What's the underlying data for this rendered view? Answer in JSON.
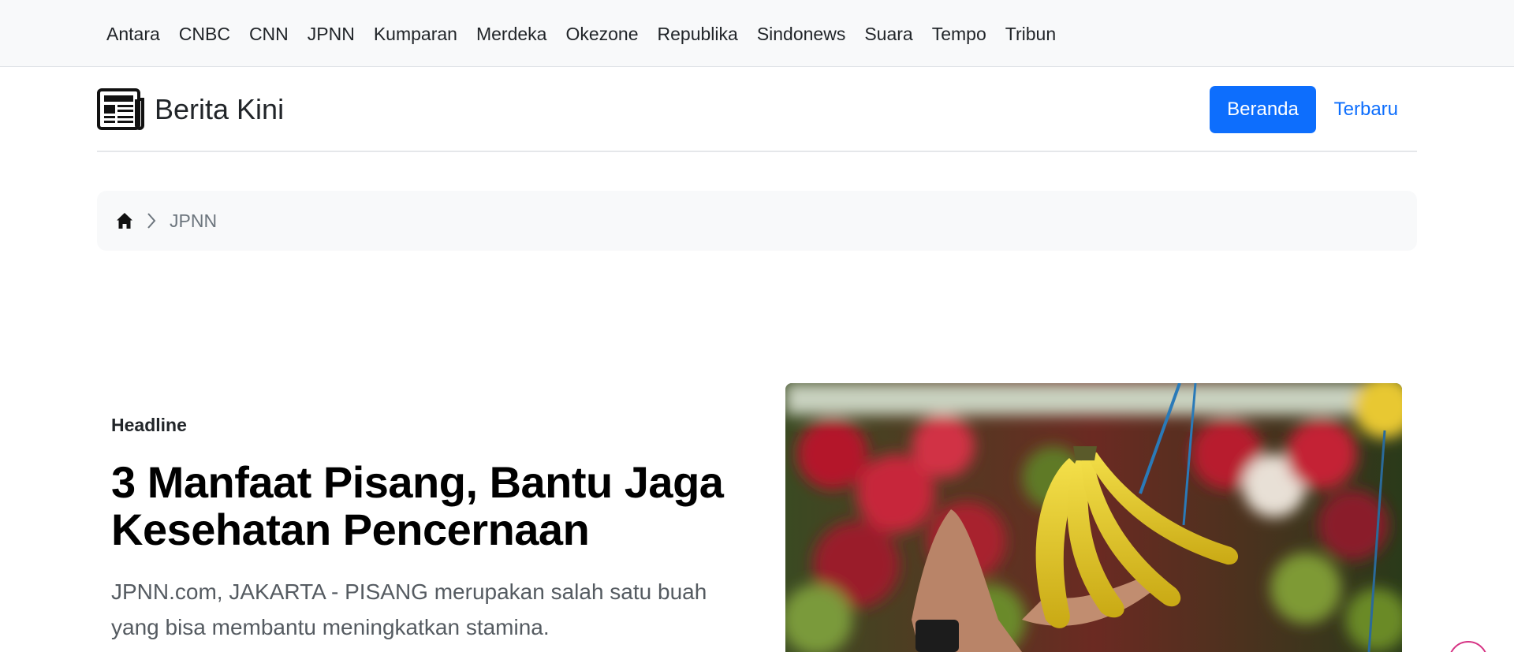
{
  "sources": [
    "Antara",
    "CNBC",
    "CNN",
    "JPNN",
    "Kumparan",
    "Merdeka",
    "Okezone",
    "Republika",
    "Sindonews",
    "Suara",
    "Tempo",
    "Tribun"
  ],
  "header": {
    "brand": "Berita Kini",
    "brand_icon": "newspaper-icon",
    "nav": {
      "home": "Beranda",
      "latest": "Terbaru"
    }
  },
  "breadcrumb": {
    "home_icon": "house-icon",
    "current": "JPNN"
  },
  "hero": {
    "label": "Headline",
    "title": "3 Manfaat Pisang, Bantu Jaga Kesehatan Pencernaan",
    "lead": "JPNN.com, JAKARTA - PISANG merupakan salah satu buah yang bisa membantu meningkatkan stamina."
  },
  "colors": {
    "primary": "#0d6efd",
    "nav_bg": "#f8f9fa",
    "fab_border": "#d63384"
  }
}
